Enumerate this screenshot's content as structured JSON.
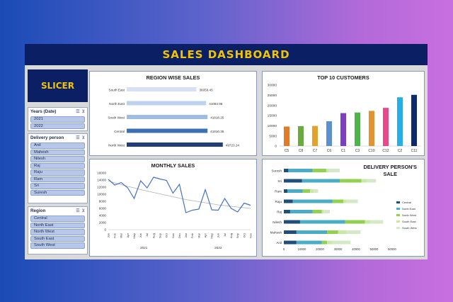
{
  "header": {
    "title": "SALES DASHBOARD"
  },
  "sidebar": {
    "title": "SLICER",
    "slicers": [
      {
        "label": "Years (Date)",
        "items": [
          "2021",
          "2022"
        ]
      },
      {
        "label": "Delivery person",
        "items": [
          "Anil",
          "Mahesh",
          "Nilesh",
          "Raj",
          "Raju",
          "Ram",
          "Sri",
          "Suresh"
        ]
      },
      {
        "label": "Region",
        "items": [
          "Central",
          "North East",
          "North West",
          "South East",
          "South West"
        ]
      }
    ]
  },
  "charts": {
    "region": {
      "title": "REGION WISE SALES"
    },
    "customers": {
      "title": "TOP 10 CUSTOMERS"
    },
    "monthly": {
      "title": "MONTHLY SALES"
    },
    "delivery": {
      "title_line1": "DELIVERY PERSON'S",
      "title_line2": "SALE"
    }
  },
  "chart_data": [
    {
      "type": "bar",
      "orientation": "horizontal",
      "title": "REGION WISE SALES",
      "categories": [
        "South East",
        "North East",
        "South West",
        "Central",
        "North West"
      ],
      "values": [
        36059.45,
        41084.96,
        41818.25,
        41810.35,
        49723.24
      ],
      "data_labels": [
        "36059.45",
        "41084.96",
        "41818.25",
        "41810.35",
        "49723.24"
      ],
      "colors": [
        "#d6e2f3",
        "#bcd2ee",
        "#9fbde3",
        "#3d6fb3",
        "#1f3f76"
      ]
    },
    {
      "type": "bar",
      "title": "TOP 10 CUSTOMERS",
      "categories": [
        "C5",
        "C8",
        "C7",
        "C6",
        "C1",
        "C3",
        "C10",
        "C12",
        "C2",
        "C11"
      ],
      "values": [
        9600,
        9800,
        9900,
        12200,
        16200,
        16500,
        17300,
        18800,
        24000,
        25200
      ],
      "ylim": [
        0,
        30000
      ],
      "yticks": [
        "0",
        "5000",
        "10000",
        "15000",
        "20000",
        "25000",
        "30000"
      ],
      "colors": [
        "#e07b2a",
        "#6aab3f",
        "#e3a22c",
        "#5b8fcf",
        "#7c3fc3",
        "#4db44c",
        "#e29331",
        "#e8498a",
        "#27aee8",
        "#0e2a6e"
      ]
    },
    {
      "type": "line",
      "title": "MONTHLY SALES",
      "x": [
        "Jan",
        "Feb",
        "Mar",
        "Apr",
        "May",
        "Jun",
        "Jul",
        "Aug",
        "Sep",
        "Oct",
        "Nov",
        "Dec",
        "Jan",
        "Feb",
        "Mar",
        "Apr",
        "May",
        "Jun",
        "Jul",
        "Aug",
        "Sep",
        "Oct",
        "Nov"
      ],
      "year_labels": [
        "2021",
        "2022"
      ],
      "values": [
        14200,
        12600,
        13300,
        11800,
        8800,
        13800,
        11800,
        14800,
        14300,
        13900,
        10300,
        12800,
        4800,
        5500,
        5800,
        11300,
        5600,
        5500,
        8800,
        6000,
        5000,
        7500,
        6900
      ],
      "trend": [
        13800,
        13200,
        12700,
        12200,
        11800,
        11300,
        10900,
        10500,
        10100,
        9700,
        9300,
        8900,
        8500,
        8200,
        7900,
        7600,
        7300,
        7000,
        6800,
        6600,
        6400,
        6200,
        6000
      ],
      "ylim": [
        0,
        16000
      ],
      "yticks": [
        "0",
        "2000",
        "4000",
        "6000",
        "8000",
        "10000",
        "12000",
        "14000",
        "16000"
      ],
      "colors": {
        "line": "#4472c4",
        "trend": "#b0b0b0"
      }
    },
    {
      "type": "bar",
      "stacked": true,
      "orientation": "horizontal",
      "title": "DELIVERY PERSON'S SALE",
      "categories": [
        "Suresh",
        "Sri",
        "Ram",
        "Raju",
        "Raj",
        "Nilesh",
        "Mahesh",
        "Anil"
      ],
      "series": [
        {
          "name": "Central",
          "values": [
            2500,
            10000,
            2000,
            5000,
            3500,
            9000,
            7000,
            7000
          ],
          "color": "#1f4e79"
        },
        {
          "name": "North East",
          "values": [
            13500,
            21000,
            8500,
            22000,
            12500,
            25000,
            17000,
            14000
          ],
          "color": "#4aacc6"
        },
        {
          "name": "North West",
          "values": [
            7500,
            12000,
            4000,
            6000,
            5000,
            11000,
            6000,
            3000
          ],
          "color": "#92d050"
        },
        {
          "name": "South East",
          "values": [
            1500,
            3000,
            2000,
            1500,
            1000,
            3000,
            4500,
            3000
          ],
          "color": "#c9e8a8"
        },
        {
          "name": "South West",
          "values": [
            6000,
            5000,
            2500,
            6500,
            3500,
            7000,
            8000,
            10000
          ],
          "color": "#d6e9c6"
        }
      ],
      "xlim": [
        0,
        60000
      ],
      "xticks": [
        "0",
        "10000",
        "20000",
        "30000",
        "40000",
        "50000",
        "60000"
      ],
      "legend": "right"
    }
  ]
}
